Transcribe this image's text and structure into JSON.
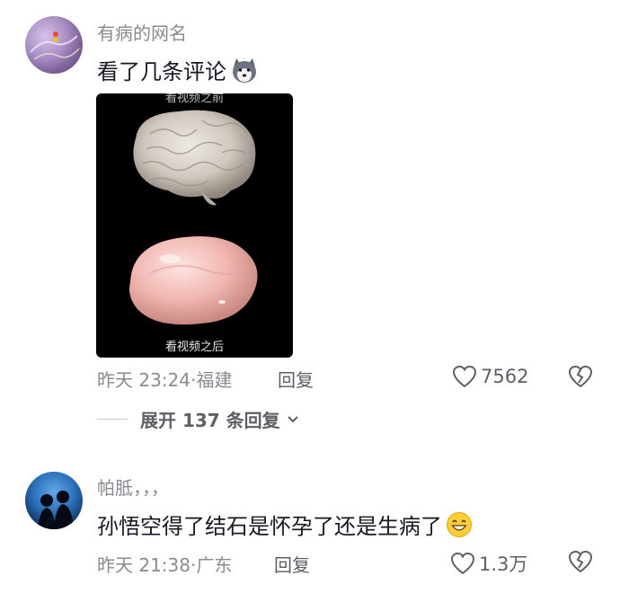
{
  "comments": [
    {
      "username": "有病的网名",
      "text": "看了几条评论",
      "emoji": "husky-emoji",
      "media": {
        "caption_top": "看视频之前",
        "caption": "看视频之后"
      },
      "time": "昨天 23:24",
      "location": "福建",
      "reply_label": "回复",
      "likes": "7562"
    },
    {
      "username": "帕胝，，，",
      "text": "孙悟空得了结石是怀孕了还是生病了",
      "emoji": "grin-emoji",
      "time": "昨天 21:38",
      "location": "广东",
      "reply_label": "回复",
      "likes": "1.3万"
    }
  ],
  "expand_replies": "展开 137 条回复"
}
